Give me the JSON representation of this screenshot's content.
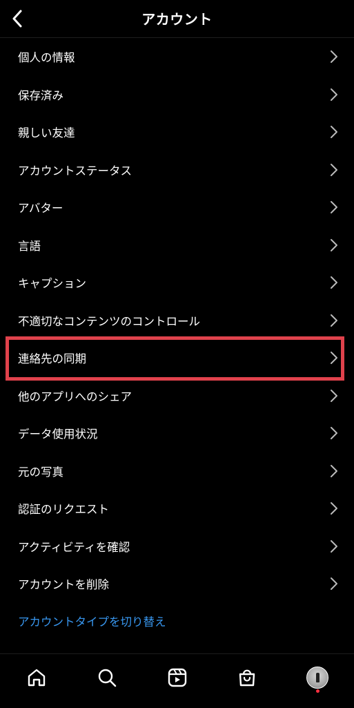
{
  "header": {
    "title": "アカウント",
    "back_icon": "chevron-left-icon"
  },
  "menu": {
    "items": [
      {
        "label": "個人の情報"
      },
      {
        "label": "保存済み"
      },
      {
        "label": "親しい友達"
      },
      {
        "label": "アカウントステータス"
      },
      {
        "label": "アバター"
      },
      {
        "label": "言語"
      },
      {
        "label": "キャプション"
      },
      {
        "label": "不適切なコンテンツのコントロール"
      },
      {
        "label": "連絡先の同期",
        "highlighted": true
      },
      {
        "label": "他のアプリへのシェア"
      },
      {
        "label": "データ使用状況"
      },
      {
        "label": "元の写真"
      },
      {
        "label": "認証のリクエスト"
      },
      {
        "label": "アクティビティを確認"
      },
      {
        "label": "アカウントを削除"
      }
    ]
  },
  "switch_account_type": "アカウントタイプを切り替え",
  "tabbar": {
    "tabs": [
      "home-icon",
      "search-icon",
      "reels-icon",
      "shop-icon",
      "profile-avatar"
    ]
  },
  "colors": {
    "background": "#000000",
    "highlight_border": "#e0424c",
    "link": "#3897f0",
    "notification_dot": "#ff3040"
  }
}
